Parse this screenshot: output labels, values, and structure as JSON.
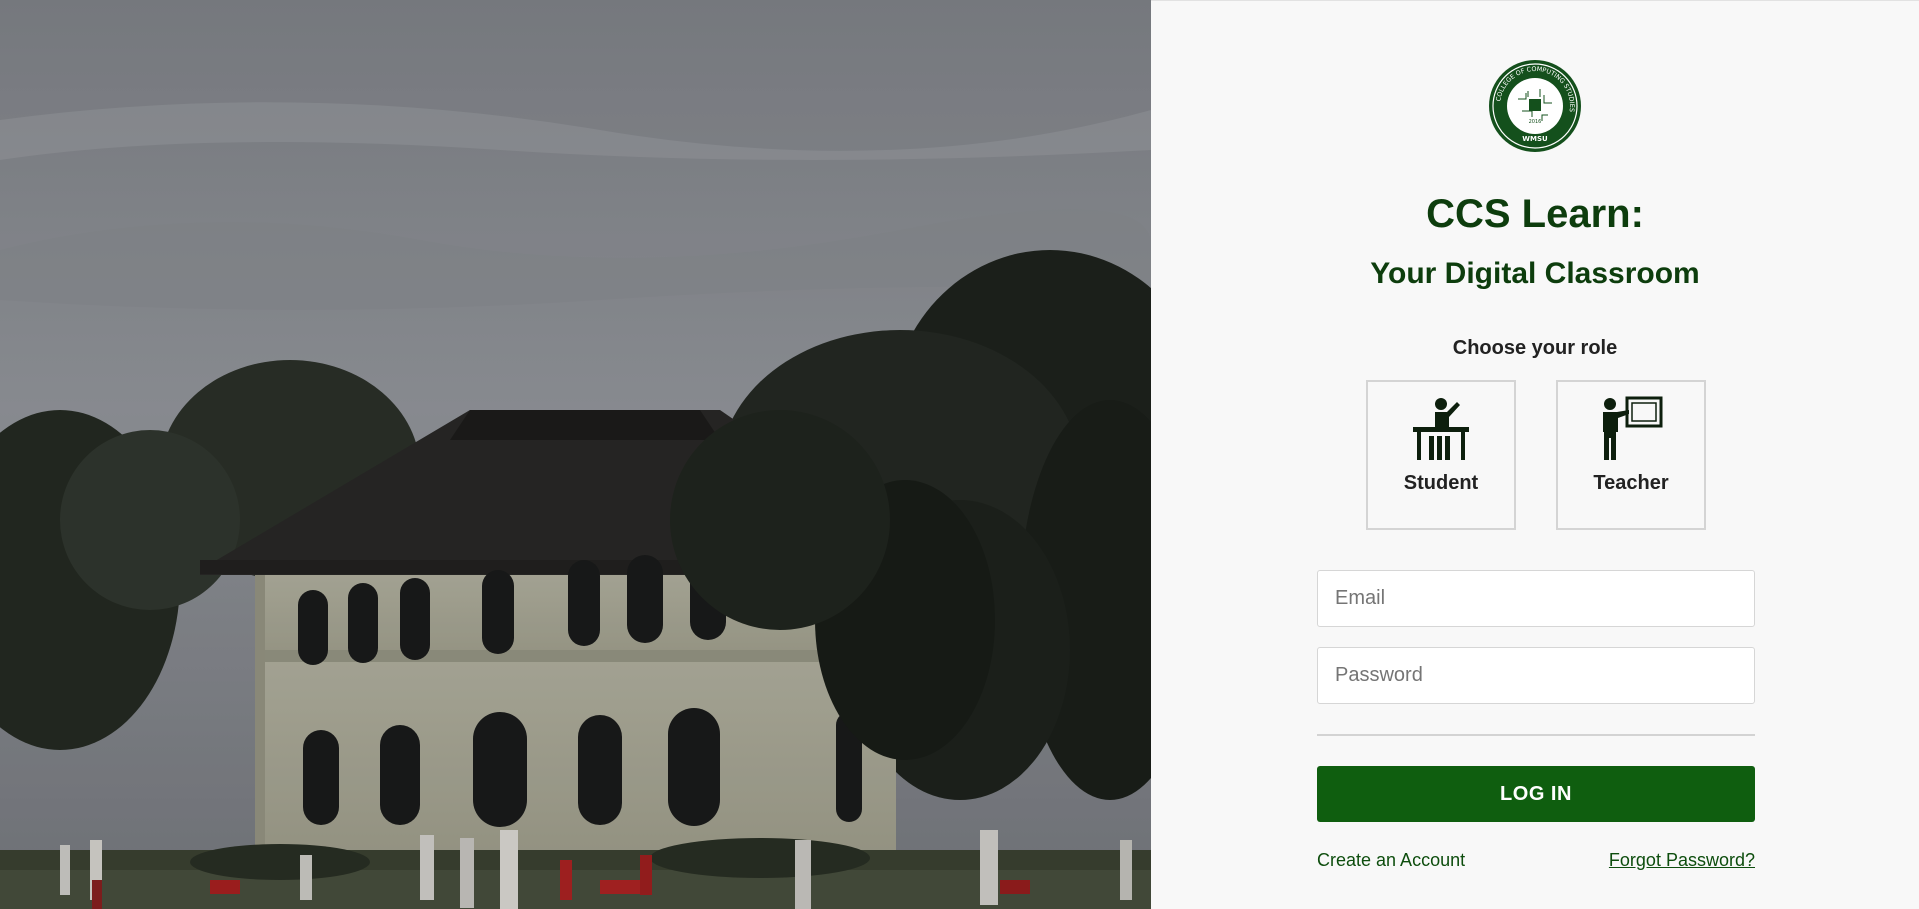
{
  "hero": {
    "description_icon": "campus-building-photo"
  },
  "brand": {
    "logo_icon": "college-seal-icon",
    "seal_ring_text": "COLLEGE OF COMPUTING STUDIES",
    "seal_year": "2016",
    "seal_short": "WMSU"
  },
  "header": {
    "title": "CCS Learn:",
    "subtitle": "Your Digital Classroom"
  },
  "roles": {
    "heading": "Choose your role",
    "items": [
      {
        "label": "Student",
        "icon": "student-desk-icon"
      },
      {
        "label": "Teacher",
        "icon": "teacher-board-icon"
      }
    ]
  },
  "form": {
    "email_placeholder": "Email",
    "password_placeholder": "Password",
    "login_label": "LOG IN"
  },
  "links": {
    "create_account": "Create an Account",
    "forgot_password": "Forgot Password?"
  },
  "colors": {
    "brand_green": "#0f5e0f",
    "title_green": "#0d3d0d",
    "panel_bg": "#f8f8f8"
  }
}
